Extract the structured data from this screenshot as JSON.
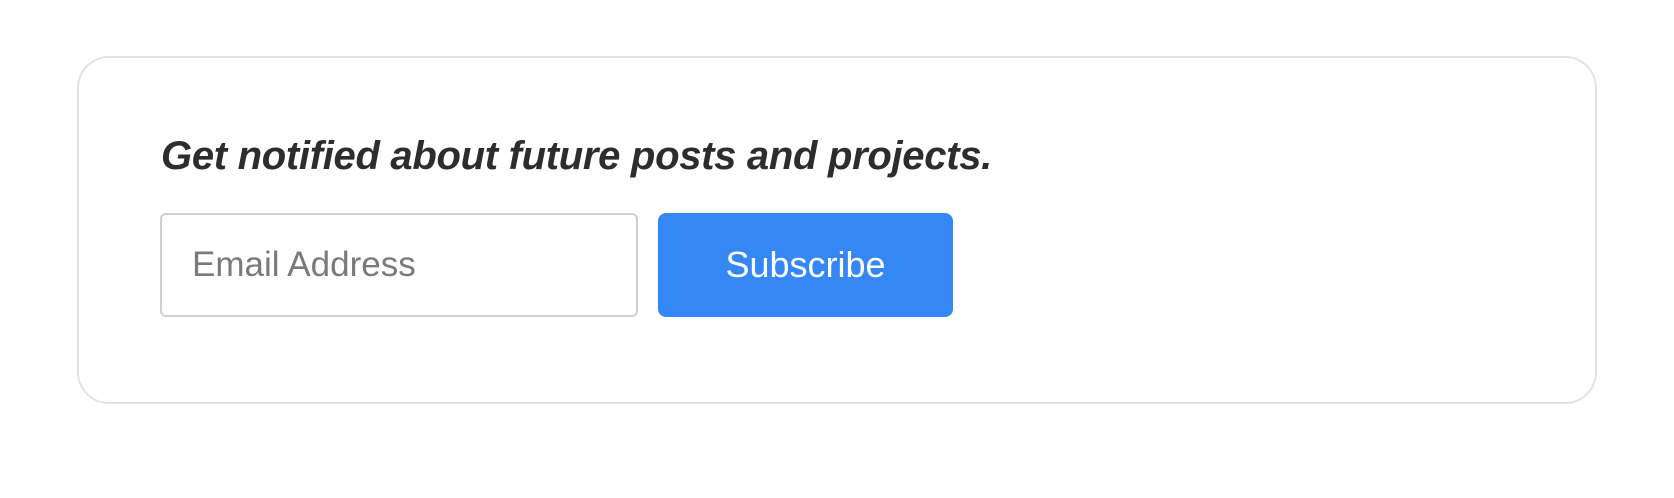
{
  "newsletter": {
    "heading": "Get notified about future posts and projects.",
    "email_placeholder": "Email Address",
    "email_value": "",
    "subscribe_label": "Subscribe"
  },
  "colors": {
    "accent": "#3587f6",
    "heading_text": "#2d2d2d",
    "border": "#e3e3e3"
  }
}
